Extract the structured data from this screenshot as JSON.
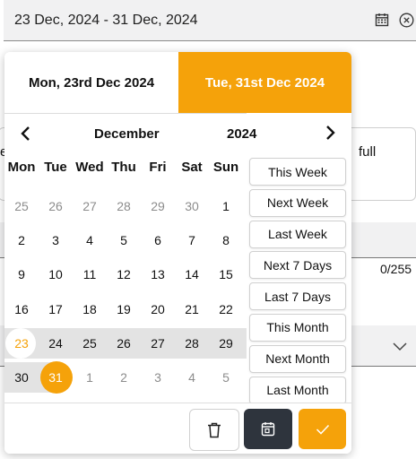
{
  "range_input": {
    "value": "23 Dec, 2024 - 31 Dec, 2024",
    "calendar_icon": "calendar-icon",
    "clear_icon": "clear-circle-icon"
  },
  "background": {
    "left_fragment": "e",
    "right_fragment": "full",
    "counter": "0/255"
  },
  "picker": {
    "start_label": "Mon, 23rd Dec 2024",
    "end_label": "Tue, 31st Dec 2024",
    "month": "December",
    "year": "2024",
    "weekdays": [
      "Mon",
      "Tue",
      "Wed",
      "Thu",
      "Fri",
      "Sat",
      "Sun"
    ],
    "weeks": [
      [
        "25",
        "26",
        "27",
        "28",
        "29",
        "30",
        "1"
      ],
      [
        "2",
        "3",
        "4",
        "5",
        "6",
        "7",
        "8"
      ],
      [
        "9",
        "10",
        "11",
        "12",
        "13",
        "14",
        "15"
      ],
      [
        "16",
        "17",
        "18",
        "19",
        "20",
        "21",
        "22"
      ],
      [
        "23",
        "24",
        "25",
        "26",
        "27",
        "28",
        "29"
      ],
      [
        "30",
        "31",
        "1",
        "2",
        "3",
        "4",
        "5"
      ]
    ],
    "presets": [
      "This Week",
      "Next Week",
      "Last Week",
      "Next 7 Days",
      "Last 7 Days",
      "This Month",
      "Next Month",
      "Last Month"
    ]
  },
  "colors": {
    "accent": "#f5a20a",
    "dark_button": "#2e343d",
    "range_band": "#e3e3e3"
  }
}
